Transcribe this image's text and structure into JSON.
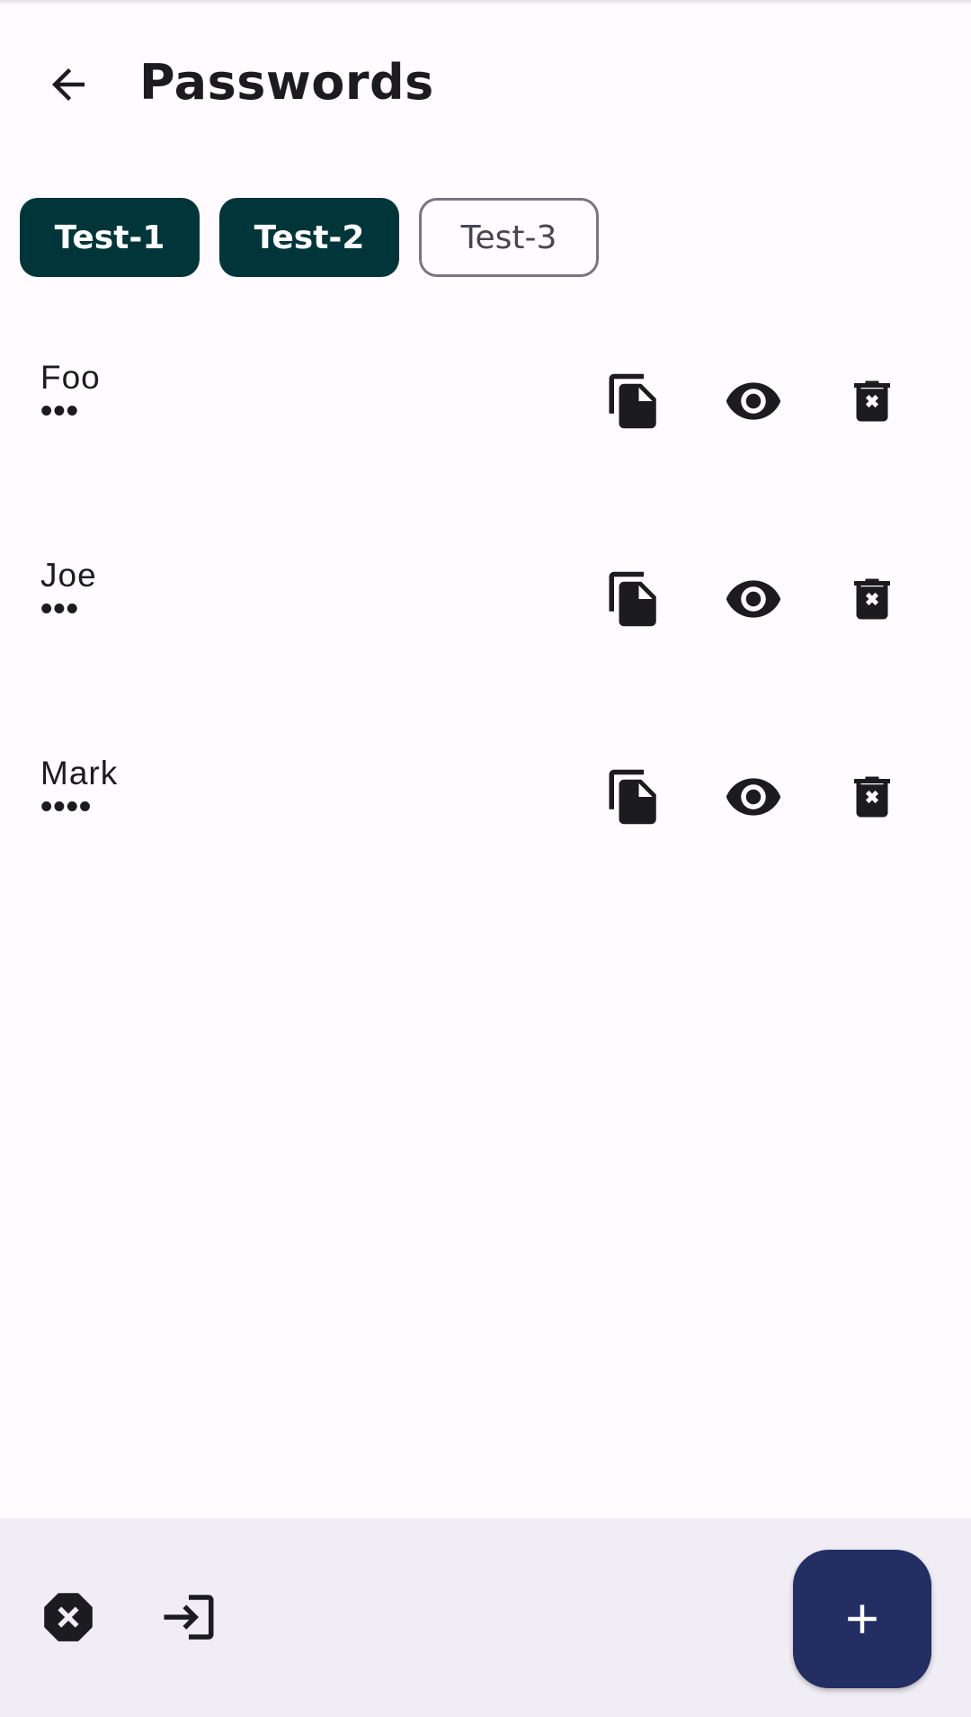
{
  "header": {
    "title": "Passwords",
    "back_icon": "arrow-back-icon"
  },
  "chips": [
    {
      "label": "Test-1",
      "selected": true
    },
    {
      "label": "Test-2",
      "selected": true
    },
    {
      "label": "Test-3",
      "selected": false
    }
  ],
  "entries": [
    {
      "name": "Foo",
      "masked": "•••"
    },
    {
      "name": "Joe",
      "masked": "•••"
    },
    {
      "name": "Mark",
      "masked": "••••"
    }
  ],
  "row_icons": [
    "copy-icon",
    "eye-icon",
    "delete-icon"
  ],
  "bottom_bar": {
    "icons": [
      "clear-icon",
      "login-icon"
    ],
    "fab_icon": "plus-icon"
  },
  "colors": {
    "chip_selected": "#00363a",
    "fab": "#232e63",
    "background": "#fffbfe",
    "bottom_bar": "#f0eef4"
  }
}
